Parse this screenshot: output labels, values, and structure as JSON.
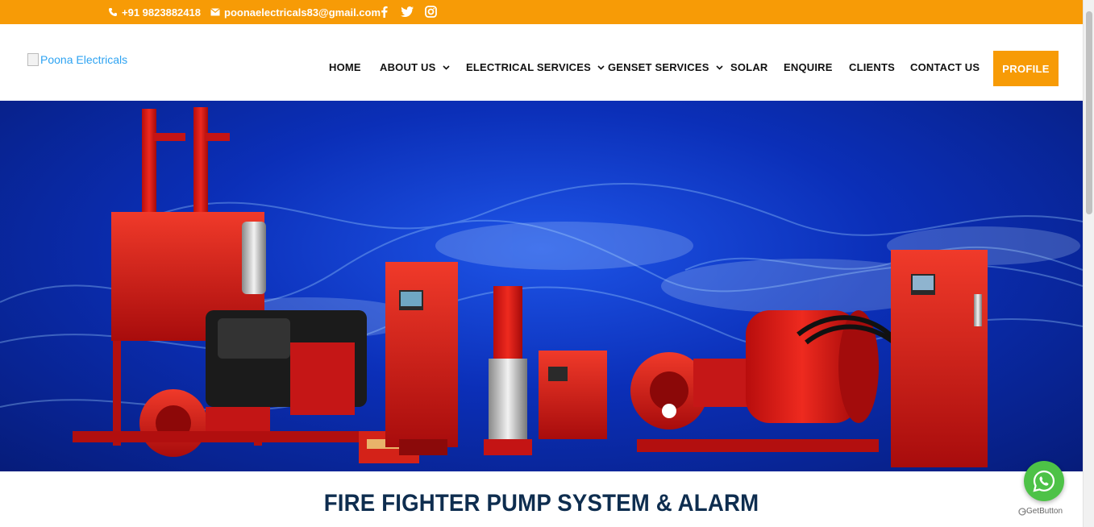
{
  "topbar": {
    "phone": "+91 9823882418",
    "email": "poonaelectricals83@gmail.com",
    "social_icons": [
      "facebook-icon",
      "twitter-icon",
      "instagram-icon"
    ],
    "bg_color": "#f79b06"
  },
  "header": {
    "logo_alt": "Poona Electricals",
    "nav": [
      {
        "label": "HOME",
        "has_dropdown": false
      },
      {
        "label": "ABOUT US",
        "has_dropdown": true
      },
      {
        "label": "ELECTRICAL SERVICES",
        "has_dropdown": true
      },
      {
        "label": "GENSET SERVICES",
        "has_dropdown": true
      },
      {
        "label": "SOLAR",
        "has_dropdown": false
      },
      {
        "label": "ENQUIRE",
        "has_dropdown": false
      },
      {
        "label": "CLIENTS",
        "has_dropdown": false
      },
      {
        "label": "CONTACT US",
        "has_dropdown": false
      }
    ],
    "profile_button": "PROFILE",
    "accent_color": "#f79b06"
  },
  "hero": {
    "image_subject": "fire-pump-equipment"
  },
  "main": {
    "headline": "FIRE FIGHTER PUMP SYSTEM & ALARM"
  },
  "widget": {
    "whatsapp_icon": "whatsapp-icon",
    "getbutton_label": "GetButton",
    "color": "#4dc247"
  }
}
